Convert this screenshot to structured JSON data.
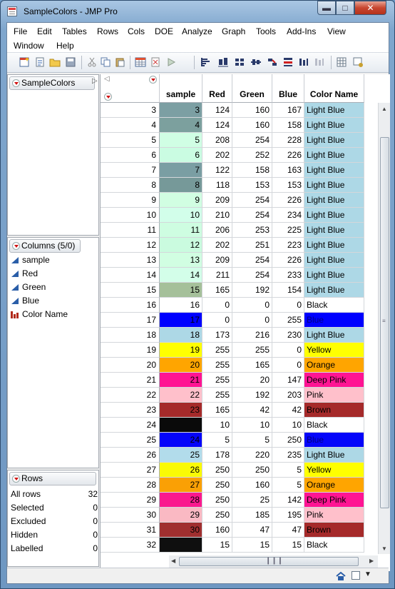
{
  "window": {
    "title": "SampleColors - JMP Pro"
  },
  "menu": [
    "File",
    "Edit",
    "Tables",
    "Rows",
    "Cols",
    "DOE",
    "Analyze",
    "Graph",
    "Tools",
    "Add-Ins",
    "View",
    "Window",
    "Help"
  ],
  "table_panel": {
    "name": "SampleColors"
  },
  "columns_panel": {
    "title": "Columns (5/0)",
    "items": [
      {
        "name": "sample",
        "icon": "continuous-icon"
      },
      {
        "name": "Red",
        "icon": "continuous-icon"
      },
      {
        "name": "Green",
        "icon": "continuous-icon"
      },
      {
        "name": "Blue",
        "icon": "continuous-icon"
      },
      {
        "name": "Color Name",
        "icon": "nominal-icon"
      }
    ]
  },
  "rows_panel": {
    "title": "Rows",
    "stats": [
      {
        "label": "All rows",
        "value": "32"
      },
      {
        "label": "Selected",
        "value": "0"
      },
      {
        "label": "Excluded",
        "value": "0"
      },
      {
        "label": "Hidden",
        "value": "0"
      },
      {
        "label": "Labelled",
        "value": "0"
      }
    ]
  },
  "grid": {
    "headers": [
      "sample",
      "Red",
      "Green",
      "Blue",
      "Color Name"
    ],
    "rows": [
      {
        "row": "3",
        "sample": "3",
        "red": "124",
        "green": "160",
        "blue": "167",
        "name": "Light Blue",
        "sample_bg": "#7c9fa3",
        "name_bg": "#add8e6",
        "name_fg": "#000000"
      },
      {
        "row": "4",
        "sample": "4",
        "red": "124",
        "green": "160",
        "blue": "158",
        "name": "Light Blue",
        "sample_bg": "#7ca09e",
        "name_bg": "#add8e6",
        "name_fg": "#000000"
      },
      {
        "row": "5",
        "sample": "5",
        "red": "208",
        "green": "254",
        "blue": "228",
        "name": "Light Blue",
        "sample_bg": "#d0fee4",
        "name_bg": "#add8e6",
        "name_fg": "#000000"
      },
      {
        "row": "6",
        "sample": "6",
        "red": "202",
        "green": "252",
        "blue": "226",
        "name": "Light Blue",
        "sample_bg": "#cafce2",
        "name_bg": "#add8e6",
        "name_fg": "#000000"
      },
      {
        "row": "7",
        "sample": "7",
        "red": "122",
        "green": "158",
        "blue": "163",
        "name": "Light Blue",
        "sample_bg": "#7a9ea3",
        "name_bg": "#add8e6",
        "name_fg": "#000000"
      },
      {
        "row": "8",
        "sample": "8",
        "red": "118",
        "green": "153",
        "blue": "153",
        "name": "Light Blue",
        "sample_bg": "#769999",
        "name_bg": "#add8e6",
        "name_fg": "#000000"
      },
      {
        "row": "9",
        "sample": "9",
        "red": "209",
        "green": "254",
        "blue": "226",
        "name": "Light Blue",
        "sample_bg": "#d1fee2",
        "name_bg": "#add8e6",
        "name_fg": "#000000"
      },
      {
        "row": "10",
        "sample": "10",
        "red": "210",
        "green": "254",
        "blue": "234",
        "name": "Light Blue",
        "sample_bg": "#d2feea",
        "name_bg": "#add8e6",
        "name_fg": "#000000"
      },
      {
        "row": "11",
        "sample": "11",
        "red": "206",
        "green": "253",
        "blue": "225",
        "name": "Light Blue",
        "sample_bg": "#cefde1",
        "name_bg": "#add8e6",
        "name_fg": "#000000"
      },
      {
        "row": "12",
        "sample": "12",
        "red": "202",
        "green": "251",
        "blue": "223",
        "name": "Light Blue",
        "sample_bg": "#cafbdf",
        "name_bg": "#add8e6",
        "name_fg": "#000000"
      },
      {
        "row": "13",
        "sample": "13",
        "red": "209",
        "green": "254",
        "blue": "226",
        "name": "Light Blue",
        "sample_bg": "#d1fee2",
        "name_bg": "#add8e6",
        "name_fg": "#000000"
      },
      {
        "row": "14",
        "sample": "14",
        "red": "211",
        "green": "254",
        "blue": "233",
        "name": "Light Blue",
        "sample_bg": "#d3fee9",
        "name_bg": "#add8e6",
        "name_fg": "#000000"
      },
      {
        "row": "15",
        "sample": "15",
        "red": "165",
        "green": "192",
        "blue": "154",
        "name": "Light Blue",
        "sample_bg": "#a5c09a",
        "name_bg": "#add8e6",
        "name_fg": "#000000"
      },
      {
        "row": "16",
        "sample": "16",
        "red": "0",
        "green": "0",
        "blue": "0",
        "name": "Black",
        "sample_bg": "#ffffff",
        "name_bg": "#ffffff",
        "name_fg": "#000000"
      },
      {
        "row": "17",
        "sample": "17",
        "red": "0",
        "green": "0",
        "blue": "255",
        "name": "Blue",
        "sample_bg": "#0000ff",
        "name_bg": "#0000ff",
        "name_fg": "#000080"
      },
      {
        "row": "18",
        "sample": "18",
        "red": "173",
        "green": "216",
        "blue": "230",
        "name": "Light Blue",
        "sample_bg": "#add8e6",
        "name_bg": "#add8e6",
        "name_fg": "#000000"
      },
      {
        "row": "19",
        "sample": "19",
        "red": "255",
        "green": "255",
        "blue": "0",
        "name": "Yellow",
        "sample_bg": "#ffff00",
        "name_bg": "#ffff00",
        "name_fg": "#000000"
      },
      {
        "row": "20",
        "sample": "20",
        "red": "255",
        "green": "165",
        "blue": "0",
        "name": "Orange",
        "sample_bg": "#ffa500",
        "name_bg": "#ffa500",
        "name_fg": "#000000"
      },
      {
        "row": "21",
        "sample": "21",
        "red": "255",
        "green": "20",
        "blue": "147",
        "name": "Deep Pink",
        "sample_bg": "#ff1493",
        "name_bg": "#ff1493",
        "name_fg": "#000000"
      },
      {
        "row": "22",
        "sample": "22",
        "red": "255",
        "green": "192",
        "blue": "203",
        "name": "Pink",
        "sample_bg": "#ffc0cb",
        "name_bg": "#ffc0cb",
        "name_fg": "#000000"
      },
      {
        "row": "23",
        "sample": "23",
        "red": "165",
        "green": "42",
        "blue": "42",
        "name": "Brown",
        "sample_bg": "#a52a2a",
        "name_bg": "#a52a2a",
        "name_fg": "#000000"
      },
      {
        "row": "24",
        "sample": "",
        "red": "10",
        "green": "10",
        "blue": "10",
        "name": "Black",
        "sample_bg": "#0a0a0a",
        "name_bg": "#ffffff",
        "name_fg": "#000000"
      },
      {
        "row": "25",
        "sample": "24",
        "red": "5",
        "green": "5",
        "blue": "250",
        "name": "Blue",
        "sample_bg": "#0505fa",
        "name_bg": "#0505fa",
        "name_fg": "#000080"
      },
      {
        "row": "26",
        "sample": "25",
        "red": "178",
        "green": "220",
        "blue": "235",
        "name": "Light Blue",
        "sample_bg": "#b2dceb",
        "name_bg": "#add8e6",
        "name_fg": "#000000"
      },
      {
        "row": "27",
        "sample": "26",
        "red": "250",
        "green": "250",
        "blue": "5",
        "name": "Yellow",
        "sample_bg": "#fafa05",
        "name_bg": "#ffff00",
        "name_fg": "#000000"
      },
      {
        "row": "28",
        "sample": "27",
        "red": "250",
        "green": "160",
        "blue": "5",
        "name": "Orange",
        "sample_bg": "#faa005",
        "name_bg": "#ffa500",
        "name_fg": "#000000"
      },
      {
        "row": "29",
        "sample": "28",
        "red": "250",
        "green": "25",
        "blue": "142",
        "name": "Deep Pink",
        "sample_bg": "#fa198e",
        "name_bg": "#ff1493",
        "name_fg": "#000000"
      },
      {
        "row": "30",
        "sample": "29",
        "red": "250",
        "green": "185",
        "blue": "195",
        "name": "Pink",
        "sample_bg": "#fab9c3",
        "name_bg": "#ffc0cb",
        "name_fg": "#000000"
      },
      {
        "row": "31",
        "sample": "30",
        "red": "160",
        "green": "47",
        "blue": "47",
        "name": "Brown",
        "sample_bg": "#a02f2f",
        "name_bg": "#a52a2a",
        "name_fg": "#000000"
      },
      {
        "row": "32",
        "sample": "",
        "red": "15",
        "green": "15",
        "blue": "15",
        "name": "Black",
        "sample_bg": "#0f0f0f",
        "name_bg": "#ffffff",
        "name_fg": "#000000"
      }
    ]
  },
  "colors": {
    "accent_red": "#d01010",
    "table_icon_blue": "#2a5ea8",
    "nominal_icon_red": "#b22a1a"
  }
}
